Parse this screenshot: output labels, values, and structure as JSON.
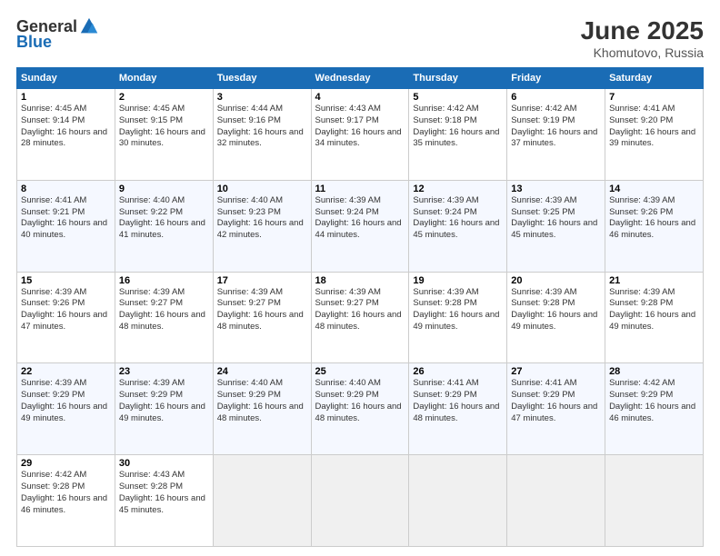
{
  "header": {
    "logo_general": "General",
    "logo_blue": "Blue",
    "month_title": "June 2025",
    "location": "Khomutovo, Russia"
  },
  "weekdays": [
    "Sunday",
    "Monday",
    "Tuesday",
    "Wednesday",
    "Thursday",
    "Friday",
    "Saturday"
  ],
  "weeks": [
    [
      {
        "day": "1",
        "sunrise": "4:45 AM",
        "sunset": "9:14 PM",
        "daylight": "16 hours and 28 minutes."
      },
      {
        "day": "2",
        "sunrise": "4:45 AM",
        "sunset": "9:15 PM",
        "daylight": "16 hours and 30 minutes."
      },
      {
        "day": "3",
        "sunrise": "4:44 AM",
        "sunset": "9:16 PM",
        "daylight": "16 hours and 32 minutes."
      },
      {
        "day": "4",
        "sunrise": "4:43 AM",
        "sunset": "9:17 PM",
        "daylight": "16 hours and 34 minutes."
      },
      {
        "day": "5",
        "sunrise": "4:42 AM",
        "sunset": "9:18 PM",
        "daylight": "16 hours and 35 minutes."
      },
      {
        "day": "6",
        "sunrise": "4:42 AM",
        "sunset": "9:19 PM",
        "daylight": "16 hours and 37 minutes."
      },
      {
        "day": "7",
        "sunrise": "4:41 AM",
        "sunset": "9:20 PM",
        "daylight": "16 hours and 39 minutes."
      }
    ],
    [
      {
        "day": "8",
        "sunrise": "4:41 AM",
        "sunset": "9:21 PM",
        "daylight": "16 hours and 40 minutes."
      },
      {
        "day": "9",
        "sunrise": "4:40 AM",
        "sunset": "9:22 PM",
        "daylight": "16 hours and 41 minutes."
      },
      {
        "day": "10",
        "sunrise": "4:40 AM",
        "sunset": "9:23 PM",
        "daylight": "16 hours and 42 minutes."
      },
      {
        "day": "11",
        "sunrise": "4:39 AM",
        "sunset": "9:24 PM",
        "daylight": "16 hours and 44 minutes."
      },
      {
        "day": "12",
        "sunrise": "4:39 AM",
        "sunset": "9:24 PM",
        "daylight": "16 hours and 45 minutes."
      },
      {
        "day": "13",
        "sunrise": "4:39 AM",
        "sunset": "9:25 PM",
        "daylight": "16 hours and 45 minutes."
      },
      {
        "day": "14",
        "sunrise": "4:39 AM",
        "sunset": "9:26 PM",
        "daylight": "16 hours and 46 minutes."
      }
    ],
    [
      {
        "day": "15",
        "sunrise": "4:39 AM",
        "sunset": "9:26 PM",
        "daylight": "16 hours and 47 minutes."
      },
      {
        "day": "16",
        "sunrise": "4:39 AM",
        "sunset": "9:27 PM",
        "daylight": "16 hours and 48 minutes."
      },
      {
        "day": "17",
        "sunrise": "4:39 AM",
        "sunset": "9:27 PM",
        "daylight": "16 hours and 48 minutes."
      },
      {
        "day": "18",
        "sunrise": "4:39 AM",
        "sunset": "9:27 PM",
        "daylight": "16 hours and 48 minutes."
      },
      {
        "day": "19",
        "sunrise": "4:39 AM",
        "sunset": "9:28 PM",
        "daylight": "16 hours and 49 minutes."
      },
      {
        "day": "20",
        "sunrise": "4:39 AM",
        "sunset": "9:28 PM",
        "daylight": "16 hours and 49 minutes."
      },
      {
        "day": "21",
        "sunrise": "4:39 AM",
        "sunset": "9:28 PM",
        "daylight": "16 hours and 49 minutes."
      }
    ],
    [
      {
        "day": "22",
        "sunrise": "4:39 AM",
        "sunset": "9:29 PM",
        "daylight": "16 hours and 49 minutes."
      },
      {
        "day": "23",
        "sunrise": "4:39 AM",
        "sunset": "9:29 PM",
        "daylight": "16 hours and 49 minutes."
      },
      {
        "day": "24",
        "sunrise": "4:40 AM",
        "sunset": "9:29 PM",
        "daylight": "16 hours and 48 minutes."
      },
      {
        "day": "25",
        "sunrise": "4:40 AM",
        "sunset": "9:29 PM",
        "daylight": "16 hours and 48 minutes."
      },
      {
        "day": "26",
        "sunrise": "4:41 AM",
        "sunset": "9:29 PM",
        "daylight": "16 hours and 48 minutes."
      },
      {
        "day": "27",
        "sunrise": "4:41 AM",
        "sunset": "9:29 PM",
        "daylight": "16 hours and 47 minutes."
      },
      {
        "day": "28",
        "sunrise": "4:42 AM",
        "sunset": "9:29 PM",
        "daylight": "16 hours and 46 minutes."
      }
    ],
    [
      {
        "day": "29",
        "sunrise": "4:42 AM",
        "sunset": "9:28 PM",
        "daylight": "16 hours and 46 minutes."
      },
      {
        "day": "30",
        "sunrise": "4:43 AM",
        "sunset": "9:28 PM",
        "daylight": "16 hours and 45 minutes."
      },
      null,
      null,
      null,
      null,
      null
    ]
  ]
}
